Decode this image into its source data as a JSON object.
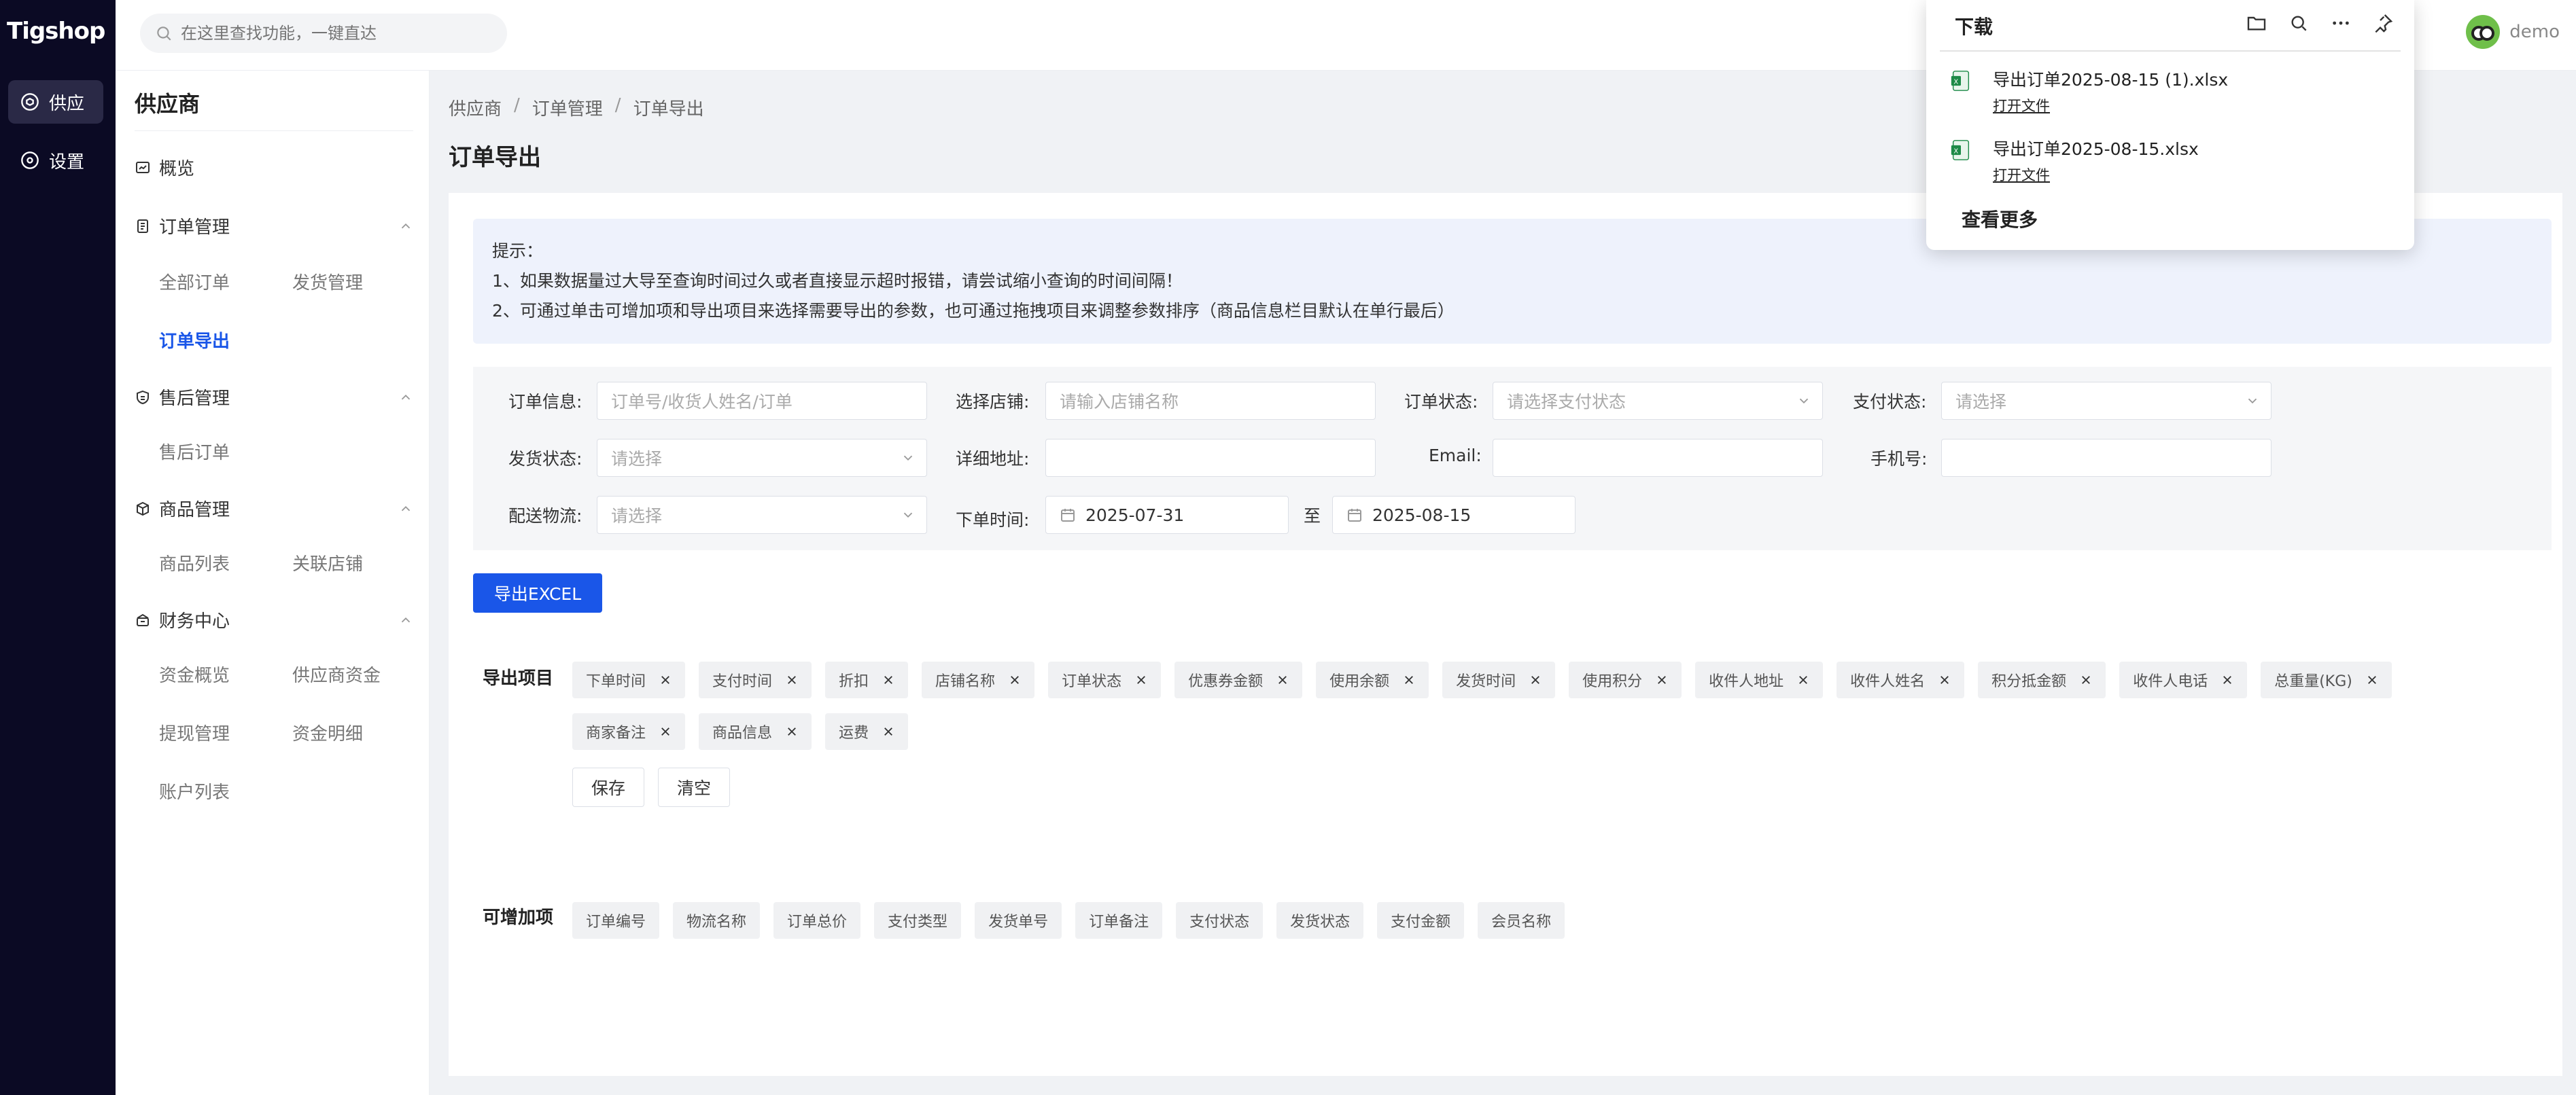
{
  "app": {
    "logo": "Tigshop"
  },
  "rail": {
    "items": [
      {
        "label": "供应",
        "icon": "cube-icon",
        "active": true
      },
      {
        "label": "设置",
        "icon": "gear-icon",
        "active": false
      }
    ]
  },
  "header": {
    "search_placeholder": "在这里查找功能，一键直达",
    "user_name": "demo"
  },
  "subnav": {
    "title": "供应商",
    "overview": "概览",
    "groups": [
      {
        "label": "订单管理",
        "items": [
          "全部订单",
          "发货管理",
          "订单导出"
        ]
      },
      {
        "label": "售后管理",
        "items": [
          "售后订单"
        ]
      },
      {
        "label": "商品管理",
        "items": [
          "商品列表",
          "关联店铺"
        ]
      },
      {
        "label": "财务中心",
        "items": [
          "资金概览",
          "供应商资金",
          "提现管理",
          "资金明细",
          "账户列表"
        ]
      }
    ]
  },
  "breadcrumb": [
    "供应商",
    "订单管理",
    "订单导出"
  ],
  "page_title": "订单导出",
  "tip": {
    "title": "提示：",
    "line1": "1、如果数据量过大导至查询时间过久或者直接显示超时报错，请尝试缩小查询的时间间隔！",
    "line2": "2、可通过单击可增加项和导出项目来选择需要导出的参数，也可通过拖拽项目来调整参数排序（商品信息栏目默认在单行最后）"
  },
  "filters": {
    "order_info": {
      "label": "订单信息:",
      "placeholder": "订单号/收货人姓名/订单"
    },
    "store": {
      "label": "选择店铺:",
      "placeholder": "请输入店铺名称"
    },
    "order_status": {
      "label": "订单状态:",
      "placeholder": "请选择支付状态"
    },
    "pay_status": {
      "label": "支付状态:",
      "placeholder": "请选择"
    },
    "ship_status": {
      "label": "发货状态:",
      "placeholder": "请选择"
    },
    "address": {
      "label": "详细地址:",
      "value": ""
    },
    "email": {
      "label": "Email:",
      "value": ""
    },
    "phone": {
      "label": "手机号:",
      "value": ""
    },
    "logistics": {
      "label": "配送物流:",
      "placeholder": "请选择"
    },
    "order_time": {
      "label": "下单时间:",
      "start": "2025-07-31",
      "to": "至",
      "end": "2025-08-15"
    }
  },
  "export_button": "导出EXCEL",
  "export_items": {
    "label": "导出项目",
    "tags": [
      "下单时间",
      "支付时间",
      "折扣",
      "店铺名称",
      "订单状态",
      "优惠券金额",
      "使用余额",
      "发货时间",
      "使用积分",
      "收件人地址",
      "收件人姓名",
      "积分抵金额",
      "收件人电话",
      "总重量(KG)",
      "商家备注",
      "商品信息",
      "运费"
    ],
    "save": "保存",
    "clear": "清空"
  },
  "addable_items": {
    "label": "可增加项",
    "tags": [
      "订单编号",
      "物流名称",
      "订单总价",
      "支付类型",
      "发货单号",
      "订单备注",
      "支付状态",
      "发货状态",
      "支付金额",
      "会员名称"
    ]
  },
  "download": {
    "title": "下载",
    "files": [
      {
        "name": "导出订单2025-08-15 (1).xlsx",
        "open": "打开文件"
      },
      {
        "name": "导出订单2025-08-15.xlsx",
        "open": "打开文件"
      }
    ],
    "more": "查看更多"
  },
  "colors": {
    "primary": "#1a56e8",
    "rail": "#0b0a24",
    "tip_bg": "#eef2fc"
  }
}
